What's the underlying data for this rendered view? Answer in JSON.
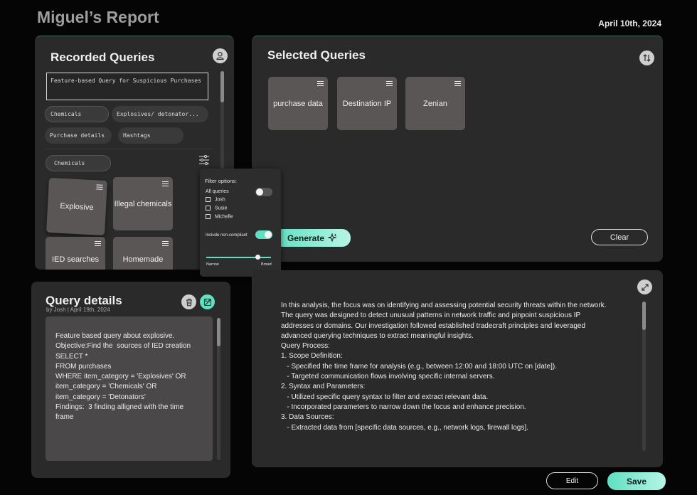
{
  "header": {
    "title": "Miguel’s Report",
    "date": "April 10th, 2024"
  },
  "recorded": {
    "title": "Recorded Queries",
    "search_value": "Feature-based Query for Suspicious Purchases",
    "tags": [
      "Chemicals",
      "Explosives/ detonator...",
      "Purchase details",
      "Hashtags"
    ],
    "active_filter": "Chemicals",
    "cards": [
      "Explosive",
      "Illegal chemicals",
      "IED searches",
      "Homemade"
    ]
  },
  "filter": {
    "title": "Filter options:",
    "all_queries": "All queries",
    "users": [
      "Josh",
      "Susie",
      "Michelle"
    ],
    "include_noncompliant": "Include non-compliant",
    "narrow": "Narrow",
    "broad": "Broad",
    "all_queries_on": false,
    "noncompliant_on": true,
    "slider_level": 0.89
  },
  "selected": {
    "title": "Selected Queries",
    "cards": [
      "purchase data",
      "Destination IP",
      "Zenian"
    ],
    "generate": "Generate",
    "clear": "Clear"
  },
  "details": {
    "title": "Query details",
    "meta": "by Josh | April 19th, 2024",
    "lines": [
      "Feature based query about explosive.",
      "",
      "Objective:Find the  sources of IED creation",
      "",
      "SELECT *",
      "FROM purchases",
      "WHERE item_category = 'Explosives' OR",
      "item_category = 'Chemicals' OR",
      "item_category = 'Detonators'",
      "",
      "Findings:  3 finding alligned with the time",
      "frame"
    ]
  },
  "analysis": {
    "lines": [
      "In this analysis, the focus was on identifying and assessing potential security threats within the network.",
      "The query was designed to detect unusual patterns in network traffic and pinpoint suspicious IP",
      "addresses or domains. Our investigation followed established tradecraft principles and leveraged",
      "advanced querying techniques to extract meaningful insights.",
      "Query Process:",
      "1. Scope Definition:",
      "   - Specified the time frame for analysis (e.g., between 12:00 and 18:00 UTC on [date]).",
      "   - Targeted communication flows involving specific internal servers.",
      "2. Syntax and Parameters:",
      "   - Utilized specific query syntax to filter and extract relevant data.",
      "   - Incorporated parameters to narrow down the focus and enhance precision.",
      "3. Data Sources:",
      "   - Extracted data from [specific data sources, e.g., network logs, firewall logs]."
    ]
  },
  "footer": {
    "edit": "Edit",
    "save": "Save"
  },
  "colors": {
    "accent": "#5fe0c2",
    "panel": "#2a2a2a",
    "card": "#5a5656",
    "background": "#050505"
  }
}
